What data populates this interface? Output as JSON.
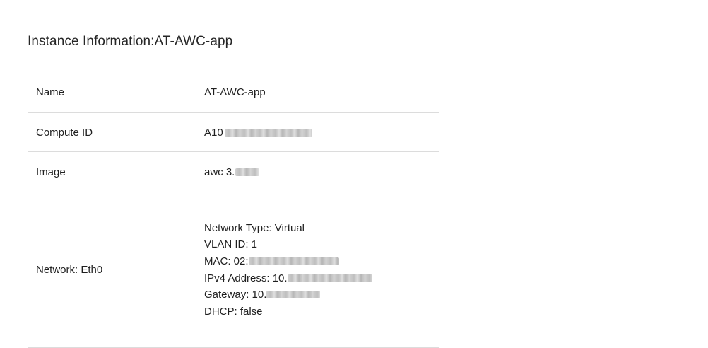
{
  "instance": {
    "title": "Instance Information:AT-AWC-app"
  },
  "details": {
    "name_label": "Name",
    "name_value": "AT-AWC-app",
    "compute_id_label": "Compute ID",
    "compute_id_value": "A10",
    "image_label": "Image",
    "image_value": "awc 3.",
    "network_label": "Network: Eth0",
    "network_lines": {
      "type": "Network Type: Virtual",
      "vlan": "VLAN ID: 1",
      "mac": "MAC: 02:",
      "ipv4": "IPv4 Address: 10.",
      "gateway": "Gateway: 10.",
      "dhcp": "DHCP: false"
    }
  }
}
